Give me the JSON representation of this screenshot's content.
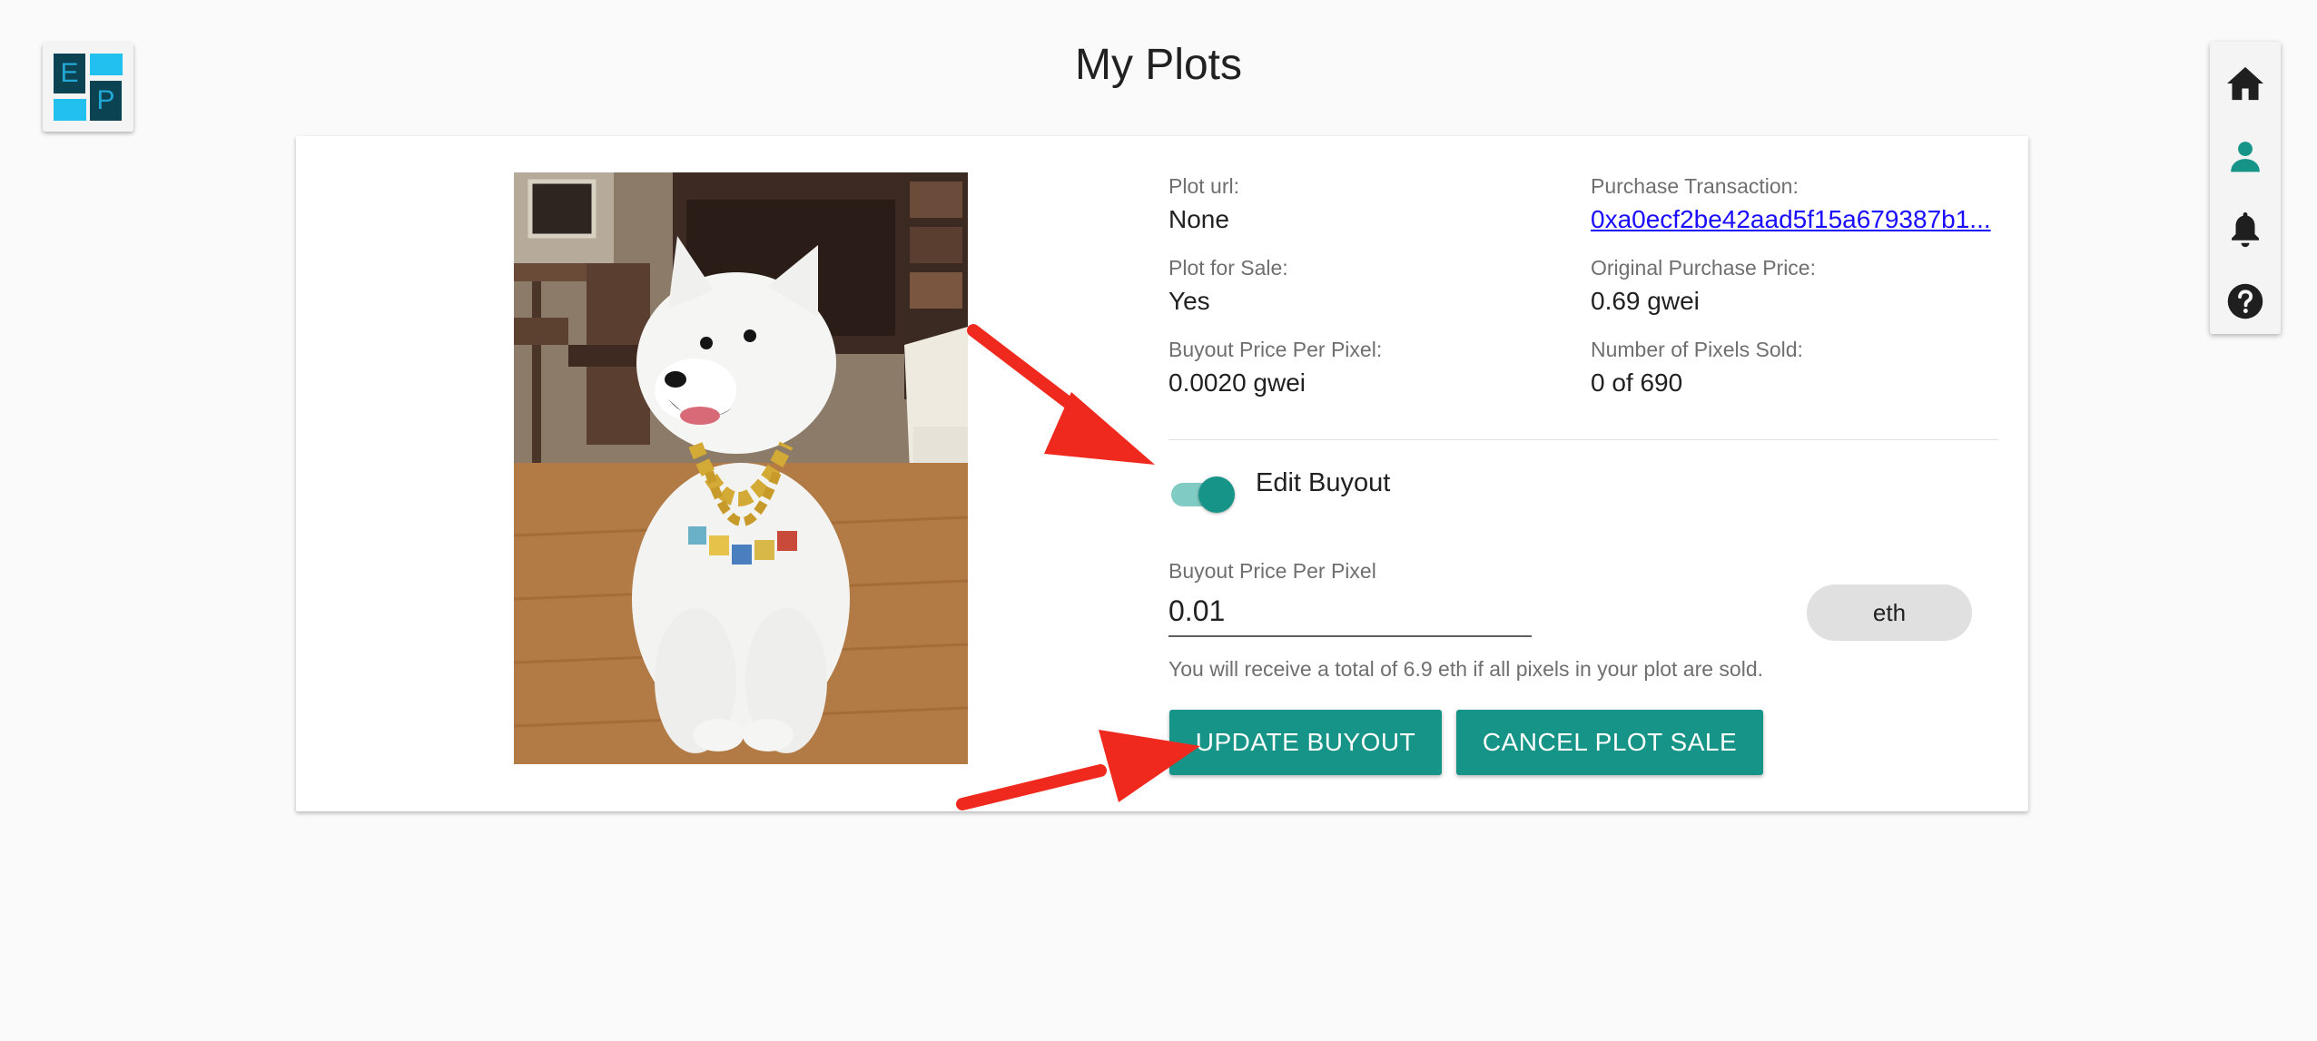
{
  "header": {
    "title": "My Plots",
    "logo_letters": [
      "E",
      "P"
    ]
  },
  "nav": {
    "items": [
      {
        "name": "home",
        "icon": "home-icon"
      },
      {
        "name": "account",
        "icon": "person-icon",
        "active": true
      },
      {
        "name": "notifications",
        "icon": "bell-icon"
      },
      {
        "name": "help",
        "icon": "help-icon"
      }
    ],
    "active_color": "#169488"
  },
  "plot": {
    "image_alt": "white samoyed dog wearing a gold chain",
    "fields": {
      "plot_url_label": "Plot url:",
      "plot_url_value": "None",
      "purchase_tx_label": "Purchase Transaction:",
      "purchase_tx_value": "0xa0ecf2be42aad5f15a679387b1...",
      "for_sale_label": "Plot for Sale:",
      "for_sale_value": "Yes",
      "original_price_label": "Original Purchase Price:",
      "original_price_value": "0.69 gwei",
      "buyout_ppp_label": "Buyout Price Per Pixel:",
      "buyout_ppp_value": "0.0020 gwei",
      "pixels_sold_label": "Number of Pixels Sold:",
      "pixels_sold_value": "0 of 690"
    },
    "edit": {
      "toggle_label": "Edit Buyout",
      "toggle_on": true,
      "input_label": "Buyout Price Per Pixel",
      "input_value": "0.01",
      "unit": "eth",
      "helper": "You will receive a total of 6.9 eth if all pixels in your plot are sold."
    },
    "actions": {
      "update": "UPDATE BUYOUT",
      "cancel": "CANCEL PLOT SALE"
    }
  },
  "colors": {
    "primary": "#169488",
    "annotation_arrow": "#f0291e",
    "link": "#1a0dff"
  }
}
